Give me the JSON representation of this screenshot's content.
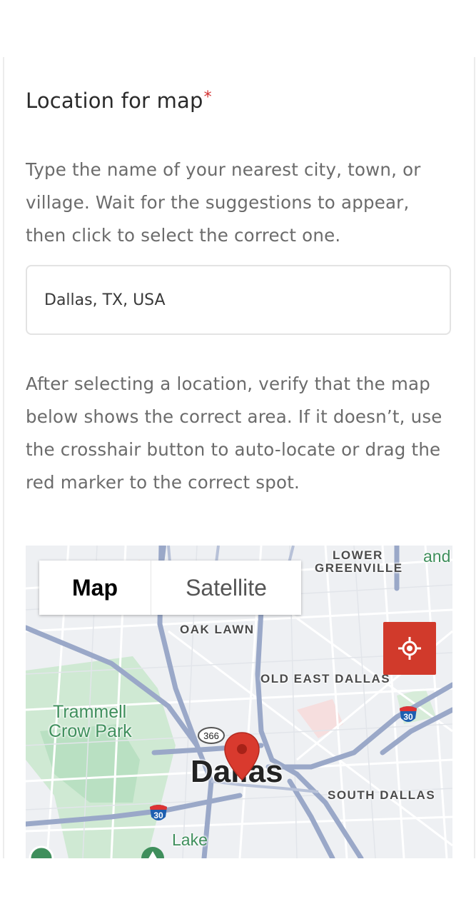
{
  "form": {
    "label": "Location for map",
    "required_mark": "*",
    "help_text": "Type the name of your nearest city, town, or village. Wait for the suggestions to appear, then click to select the correct one.",
    "location_value": "Dallas, TX, USA",
    "verify_text": "After selecting a location, verify that the map below shows the correct area. If it doesn’t, use the crosshair button to auto-locate or drag the red marker to the correct spot."
  },
  "map": {
    "type_buttons": {
      "map": "Map",
      "satellite": "Satellite"
    },
    "selected_type": "Map",
    "labels": {
      "lower_greenville_1": "LOWER",
      "lower_greenville_2": "GREENVILLE",
      "oak_lawn": "OAK LAWN",
      "old_east_dallas": "OLD EAST DALLAS",
      "trammell_1": "Trammell",
      "trammell_2": "Crow Park",
      "city": "Dallas",
      "south_dallas": "SOUTH DALLAS",
      "and": "and",
      "lake": "Lake"
    },
    "shields": {
      "route_366": "366",
      "i30_east": "30",
      "i30_west": "30"
    },
    "icons": {
      "locate": "crosshair-icon",
      "marker": "map-pin-icon"
    },
    "colors": {
      "locate_button": "#d13a2b",
      "marker": "#d93a2e",
      "park": "#c9e8cf",
      "highway": "#9aa8c8"
    }
  }
}
